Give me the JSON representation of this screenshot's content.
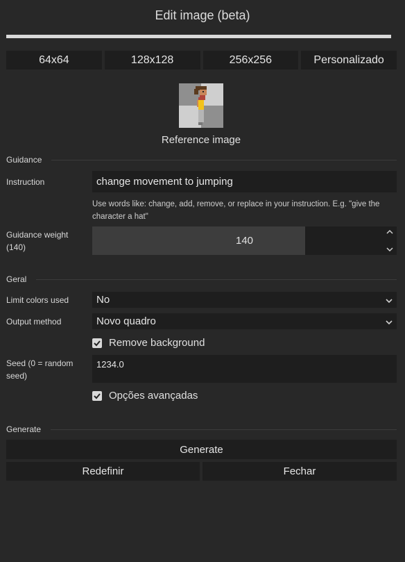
{
  "dialog": {
    "title": "Edit image (beta)",
    "progress": 1.0
  },
  "size_buttons": [
    "64x64",
    "128x128",
    "256x256",
    "Personalizado"
  ],
  "reference": {
    "caption": "Reference image"
  },
  "guidance": {
    "section_label": "Guidance",
    "instruction_label": "Instruction",
    "instruction_value": "change movement to jumping",
    "hint": "Use words like: change, add, remove, or replace in your instruction. E.g. \"give the character a hat\"",
    "weight_label": "Guidance weight (140)",
    "weight_value": "140",
    "weight_fraction": 0.7
  },
  "geral": {
    "section_label": "Geral",
    "limit_colors_label": "Limit colors used",
    "limit_colors_value": "No",
    "output_method_label": "Output method",
    "output_method_value": "Novo quadro",
    "remove_background_label": "Remove background",
    "remove_background_checked": true,
    "seed_label": "Seed (0 = random seed)",
    "seed_value": "1234.0",
    "advanced_label": "Opções avançadas",
    "advanced_checked": true
  },
  "generate": {
    "section_label": "Generate",
    "generate_label": "Generate",
    "reset_label": "Redefinir",
    "close_label": "Fechar"
  }
}
